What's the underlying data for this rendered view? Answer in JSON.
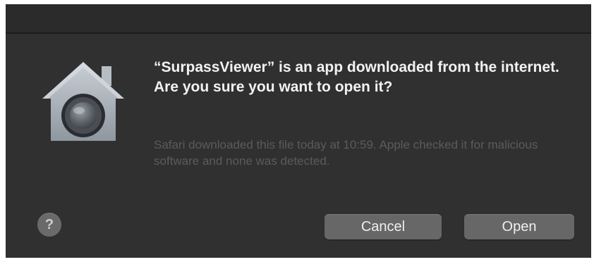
{
  "dialog": {
    "message": "“SurpassViewer” is an app downloaded from the internet. Are you sure you want to open it?",
    "detail": "Safari downloaded this file today at 10:59. Apple checked it for malicious software and none was detected.",
    "icon": "gatekeeper-house-icon",
    "help_label": "?",
    "cancel_label": "Cancel",
    "open_label": "Open"
  },
  "colors": {
    "dialog_background": "#303030",
    "titlebar_background": "#2b2b2b",
    "message_text": "#f2f2f2",
    "detail_text": "#5b5b5b",
    "button_background": "#676767"
  }
}
